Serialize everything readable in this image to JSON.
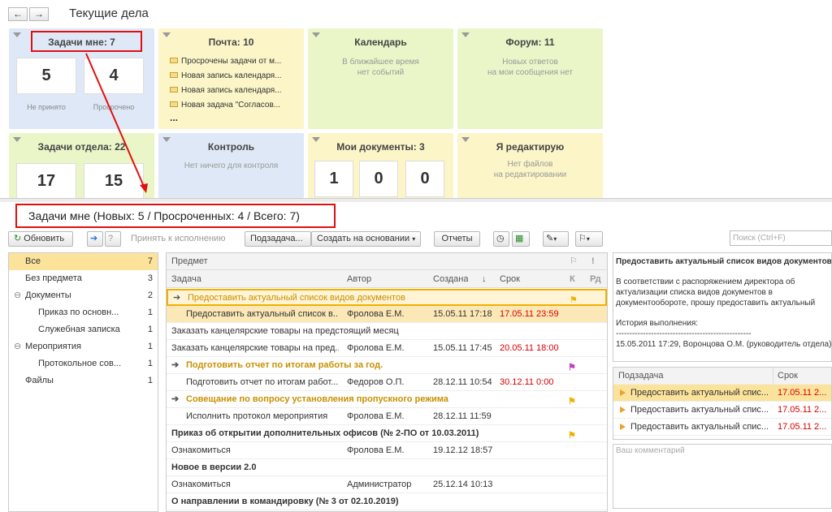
{
  "window": {
    "title": "Текущие дела",
    "back_icon": "←",
    "fwd_icon": "→"
  },
  "tiles": {
    "my_tasks": {
      "title": "Задачи мне: 7",
      "new_val": "5",
      "new_label": "Не принято",
      "overdue_val": "4",
      "overdue_label": "Просрочено"
    },
    "mail": {
      "title": "Почта: 10",
      "items": [
        "Просрочены задачи от м...",
        "Новая запись календаря...",
        "Новая запись календаря...",
        "Новая задача \"Согласов..."
      ],
      "more": "..."
    },
    "calendar": {
      "title": "Календарь",
      "line1": "В ближайшее время",
      "line2": "нет событий"
    },
    "forum": {
      "title": "Форум: 11",
      "line1": "Новых ответов",
      "line2": "на мои сообщения нет"
    },
    "dept_tasks": {
      "title": "Задачи отдела: 22",
      "val1": "17",
      "val2": "15"
    },
    "control": {
      "title": "Контроль",
      "line1": "Нет ничего для контроля"
    },
    "my_docs": {
      "title": "Мои документы: 3",
      "v1": "1",
      "v2": "0",
      "v3": "0"
    },
    "editing": {
      "title": "Я редактирую",
      "line1": "Нет файлов",
      "line2": "на редактировании"
    }
  },
  "section": {
    "title": "Задачи мне (Новых: 5 / Просроченных: 4 / Всего: 7)"
  },
  "toolbar": {
    "refresh": "Обновить",
    "accept": "Принять к исполнению",
    "subtask": "Подзадача...",
    "create_based": "Создать на основании",
    "reports": "Отчеты",
    "search_placeholder": "Поиск (Ctrl+F)"
  },
  "left_tree": [
    {
      "label": "Все",
      "count": "7"
    },
    {
      "label": "Без предмета",
      "count": "3"
    },
    {
      "label": "Документы",
      "count": "2"
    },
    {
      "label": "Приказ по основн...",
      "count": "1"
    },
    {
      "label": "Служебная записка",
      "count": "1"
    },
    {
      "label": "Мероприятия",
      "count": "1"
    },
    {
      "label": "Протокольное сов...",
      "count": "1"
    },
    {
      "label": "Файлы",
      "count": "1"
    }
  ],
  "grid": {
    "col_subject": "Предмет",
    "col_task": "Задача",
    "col_author": "Автор",
    "col_created": "Создана",
    "col_due": "Срок",
    "col_k": "К",
    "col_rd": "Рд",
    "sort_icon": "↓",
    "rows": [
      {
        "task": "Предоставить актуальный список видов документов",
        "author": "",
        "created": "",
        "due": ""
      },
      {
        "task": "Предоставить актуальный список в...",
        "author": "Фролова Е.М.",
        "created": "15.05.11 17:18",
        "due": "17.05.11 23:59"
      },
      {
        "task": "Заказать канцелярские товары на предстоящий месяц",
        "author": "",
        "created": "",
        "due": ""
      },
      {
        "task": "Заказать канцелярские товары на пред...",
        "author": "Фролова Е.М.",
        "created": "15.05.11 17:45",
        "due": "20.05.11 18:00"
      },
      {
        "task": "Подготовить отчет по итогам работы за год.",
        "author": "",
        "created": "",
        "due": ""
      },
      {
        "task": "Подготовить отчет по итогам работ...",
        "author": "Федоров О.П.",
        "created": "28.12.11 10:54",
        "due": "30.12.11 0:00"
      },
      {
        "task": "Совещание по вопросу установления пропускного режима",
        "author": "",
        "created": "",
        "due": ""
      },
      {
        "task": "Исполнить протокол мероприятия",
        "author": "Фролова Е.М.",
        "created": "28.12.11 11:59",
        "due": ""
      },
      {
        "task": "Приказ об открытии дополнительных офисов (№ 2-ПО от 10.03.2011)",
        "author": "",
        "created": "",
        "due": ""
      },
      {
        "task": "Ознакомиться",
        "author": "Фролова Е.М.",
        "created": "19.12.12 18:57",
        "due": ""
      },
      {
        "task": "Новое в версии 2.0",
        "author": "",
        "created": "",
        "due": ""
      },
      {
        "task": "Ознакомиться",
        "author": "Администратор",
        "created": "25.12.14 10:13",
        "due": ""
      },
      {
        "task": "О направлении в командировку (№ 3 от 02.10.2019)",
        "author": "",
        "created": "",
        "due": ""
      }
    ]
  },
  "detail": {
    "title": "Предоставить актуальный список видов документов",
    "text": "В соответствии с распоряжением директора об актуализации списка видов документов в документообороте, прошу предоставить актуальный список видов документов, которые используются в Вашем подразделении.",
    "history_label": "История выполнения:",
    "separator": "--------------------------------------------------",
    "history_entry": "15.05.2011 17:29, Воронцова О.М. (руководитель отдела)"
  },
  "subtasks": {
    "col_sub": "Подзадача",
    "col_due": "Срок",
    "rows": [
      {
        "name": "Предоставить актуальный спис...",
        "due": "17.05.11 2..."
      },
      {
        "name": "Предоставить актуальный спис...",
        "due": "17.05.11 2..."
      },
      {
        "name": "Предоставить актуальный спис...",
        "due": "17.05.11 2..."
      }
    ]
  },
  "comment": {
    "placeholder": "Ваш комментарий"
  }
}
